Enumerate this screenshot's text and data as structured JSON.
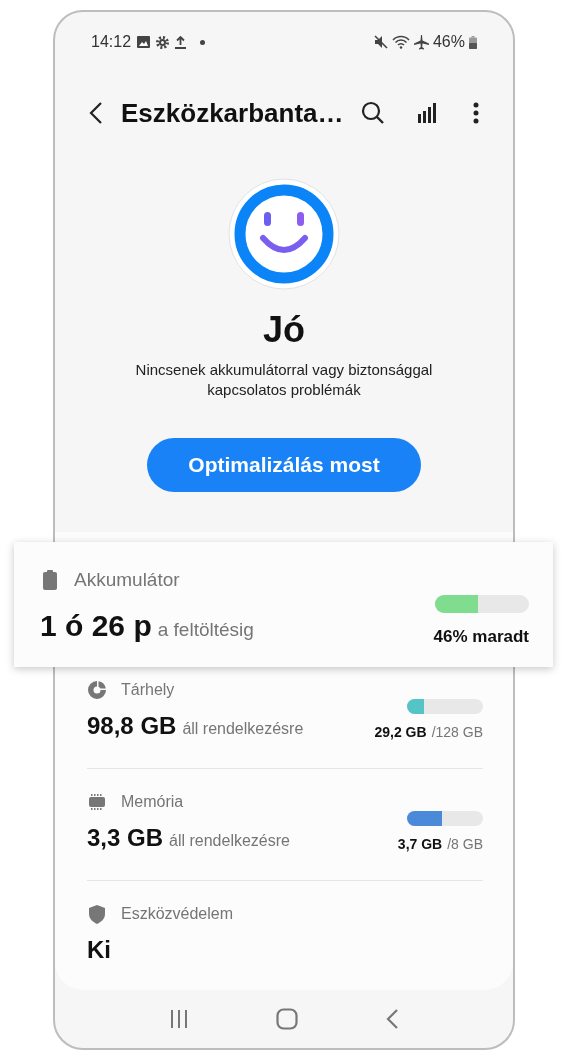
{
  "status_bar": {
    "time": "14:12",
    "battery": "46%"
  },
  "toolbar": {
    "title": "Eszközkarbanta…"
  },
  "summary": {
    "status": "Jó",
    "description": "Nincsenek akkumulátorral vagy biztonsággal kapcsolatos problémák",
    "button": "Optimalizálás most"
  },
  "items": [
    {
      "kind": "battery",
      "title": "Akkumulátor",
      "value": "1 ó 26 p",
      "suffix": "a feltöltésig",
      "level": 0.46,
      "color": "#80dc8f",
      "used": "46% maradt"
    },
    {
      "kind": "storage",
      "title": "Tárhely",
      "value": "98,8 GB",
      "suffix": "áll rendelkezésre",
      "level": 0.23,
      "color": "#54c4c6",
      "used": "29,2 GB",
      "total": "/128 GB"
    },
    {
      "kind": "memory",
      "title": "Memória",
      "value": "3,3 GB",
      "suffix": "áll rendelkezésre",
      "level": 0.46,
      "color": "#4a8ad8",
      "used": "3,7 GB",
      "total": "/8 GB"
    },
    {
      "kind": "security",
      "title": "Eszközvédelem",
      "value": "Ki"
    }
  ]
}
